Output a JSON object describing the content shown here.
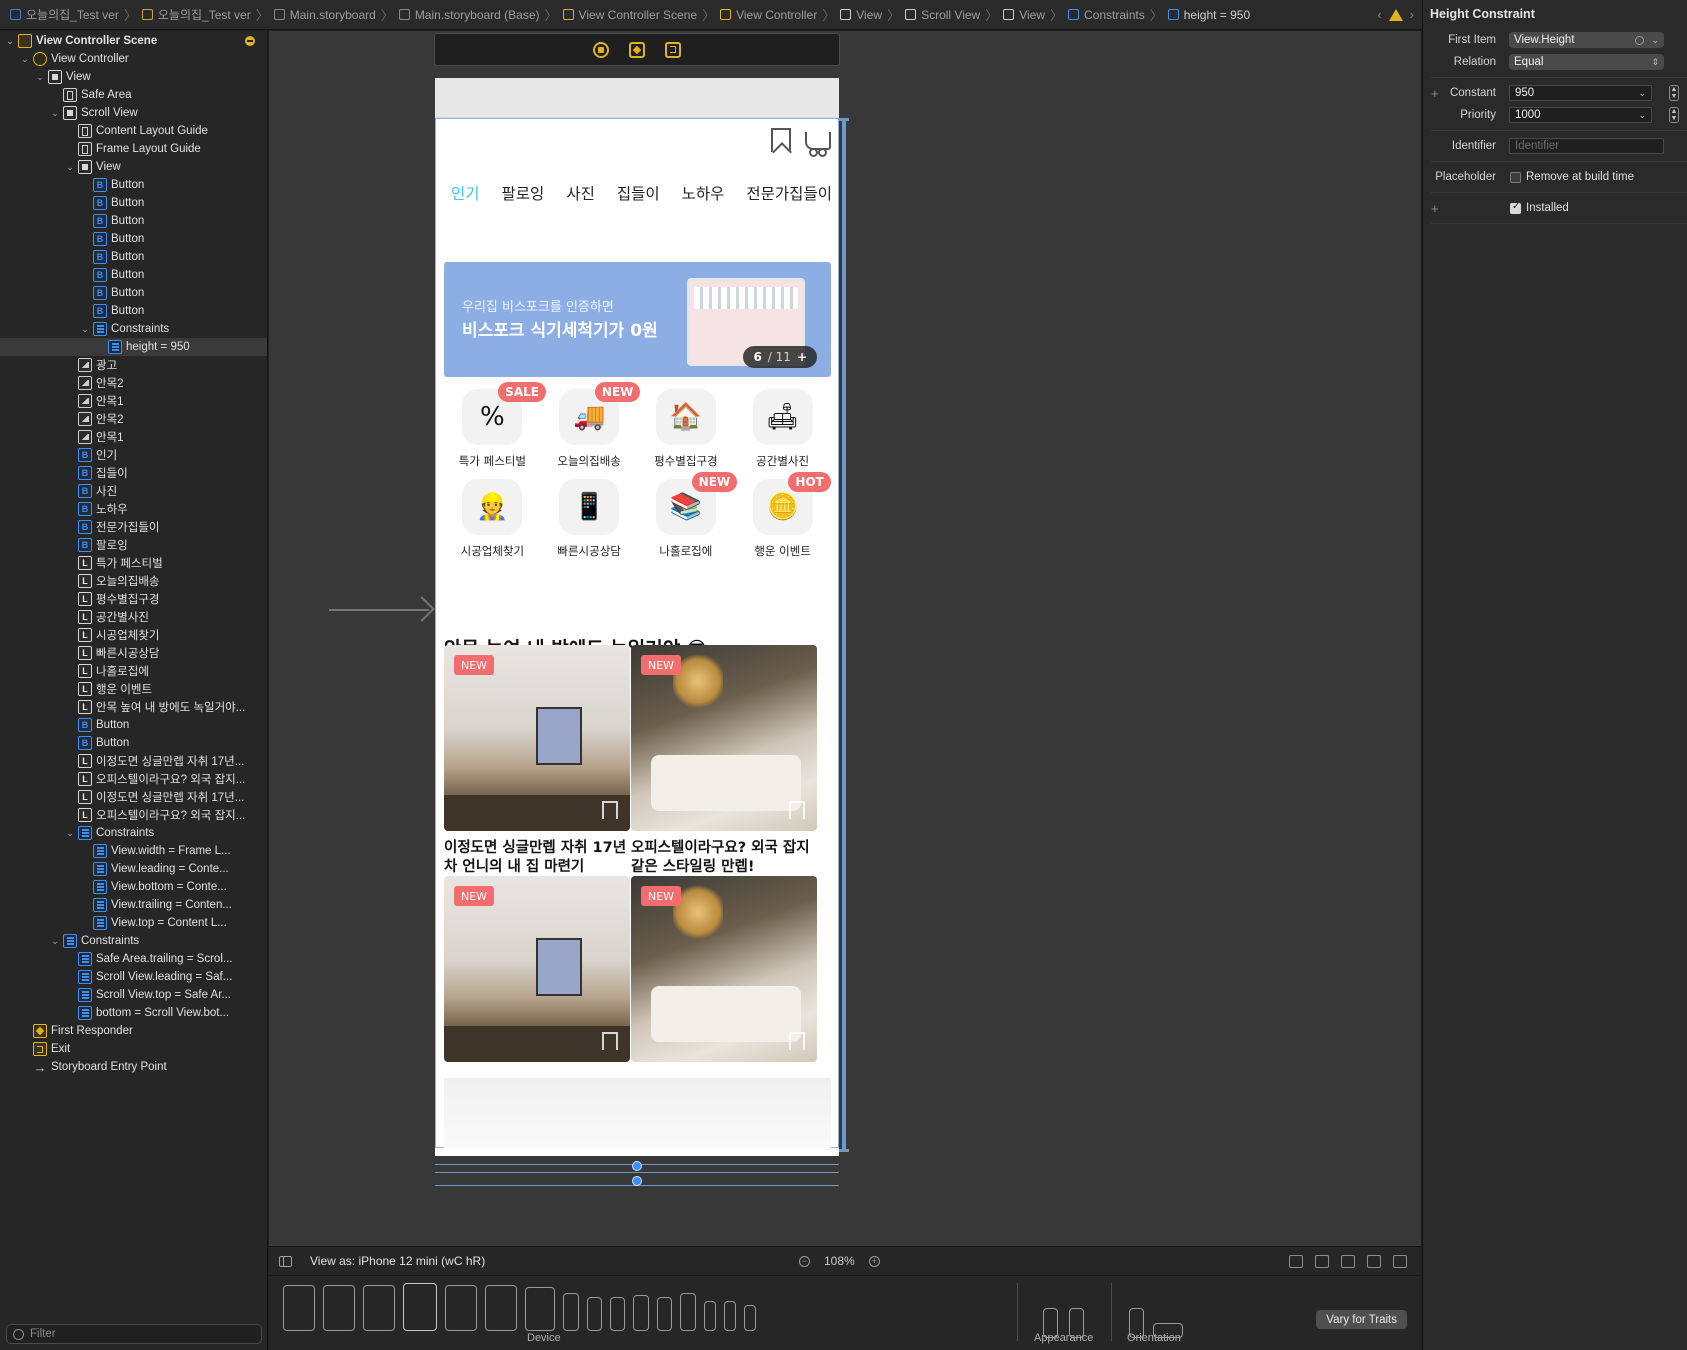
{
  "breadcrumbs": [
    {
      "label": "오늘의집_Test ver",
      "icon": "swift-file-icon",
      "color": "#4a7ad8"
    },
    {
      "label": "오늘의집_Test ver",
      "icon": "folder-icon",
      "color": "#c9a24a"
    },
    {
      "label": "Main.storyboard",
      "icon": "storyboard-icon",
      "color": "#8a8a8a"
    },
    {
      "label": "Main.storyboard (Base)",
      "icon": "storyboard-icon",
      "color": "#8a8a8a"
    },
    {
      "label": "View Controller Scene",
      "icon": "scene-icon",
      "color": "#e0b21c"
    },
    {
      "label": "View Controller",
      "icon": "view-controller-icon",
      "color": "#e0b21c"
    },
    {
      "label": "View",
      "icon": "view-icon",
      "color": "#cfcfcf"
    },
    {
      "label": "Scroll View",
      "icon": "scroll-view-icon",
      "color": "#cfcfcf"
    },
    {
      "label": "View",
      "icon": "view-icon",
      "color": "#cfcfcf"
    },
    {
      "label": "Constraints",
      "icon": "constraints-icon",
      "color": "#3d8ff5"
    },
    {
      "label": "height = 950",
      "icon": "constraint-icon",
      "color": "#3d8ff5"
    }
  ],
  "outline": {
    "items": [
      {
        "label": "View Controller Scene",
        "depth": 0,
        "icon": "scene",
        "disclosure": "▾",
        "bold": true
      },
      {
        "label": "View Controller",
        "depth": 1,
        "icon": "vc",
        "disclosure": "▾"
      },
      {
        "label": "View",
        "depth": 2,
        "icon": "view",
        "disclosure": "▾"
      },
      {
        "label": "Safe Area",
        "depth": 3,
        "icon": "guide",
        "disclosure": ""
      },
      {
        "label": "Scroll View",
        "depth": 3,
        "icon": "view",
        "disclosure": "▾"
      },
      {
        "label": "Content Layout Guide",
        "depth": 4,
        "icon": "guide",
        "disclosure": ""
      },
      {
        "label": "Frame Layout Guide",
        "depth": 4,
        "icon": "guide",
        "disclosure": ""
      },
      {
        "label": "View",
        "depth": 4,
        "icon": "view",
        "disclosure": "▾"
      },
      {
        "label": "Button",
        "depth": 5,
        "icon": "btn",
        "disclosure": ""
      },
      {
        "label": "Button",
        "depth": 5,
        "icon": "btn",
        "disclosure": ""
      },
      {
        "label": "Button",
        "depth": 5,
        "icon": "btn",
        "disclosure": ""
      },
      {
        "label": "Button",
        "depth": 5,
        "icon": "btn",
        "disclosure": ""
      },
      {
        "label": "Button",
        "depth": 5,
        "icon": "btn",
        "disclosure": ""
      },
      {
        "label": "Button",
        "depth": 5,
        "icon": "btn",
        "disclosure": ""
      },
      {
        "label": "Button",
        "depth": 5,
        "icon": "btn",
        "disclosure": ""
      },
      {
        "label": "Button",
        "depth": 5,
        "icon": "btn",
        "disclosure": ""
      },
      {
        "label": "Constraints",
        "depth": 5,
        "icon": "cons",
        "disclosure": "▾"
      },
      {
        "label": "height = 950",
        "depth": 6,
        "icon": "cons",
        "disclosure": "",
        "selected": true
      },
      {
        "label": "광고",
        "depth": 4,
        "icon": "img",
        "disclosure": ""
      },
      {
        "label": "안목2",
        "depth": 4,
        "icon": "img",
        "disclosure": ""
      },
      {
        "label": "안목1",
        "depth": 4,
        "icon": "img",
        "disclosure": ""
      },
      {
        "label": "안목2",
        "depth": 4,
        "icon": "img",
        "disclosure": ""
      },
      {
        "label": "안목1",
        "depth": 4,
        "icon": "img",
        "disclosure": ""
      },
      {
        "label": "인기",
        "depth": 4,
        "icon": "btn",
        "disclosure": ""
      },
      {
        "label": "집들이",
        "depth": 4,
        "icon": "btn",
        "disclosure": ""
      },
      {
        "label": "사진",
        "depth": 4,
        "icon": "btn",
        "disclosure": ""
      },
      {
        "label": "노하우",
        "depth": 4,
        "icon": "btn",
        "disclosure": ""
      },
      {
        "label": "전문가집들이",
        "depth": 4,
        "icon": "btn",
        "disclosure": ""
      },
      {
        "label": "팔로잉",
        "depth": 4,
        "icon": "btn",
        "disclosure": ""
      },
      {
        "label": "특가 페스티벌",
        "depth": 4,
        "icon": "lbl",
        "disclosure": ""
      },
      {
        "label": "오늘의집배송",
        "depth": 4,
        "icon": "lbl",
        "disclosure": ""
      },
      {
        "label": "평수별집구경",
        "depth": 4,
        "icon": "lbl",
        "disclosure": ""
      },
      {
        "label": "공간별사진",
        "depth": 4,
        "icon": "lbl",
        "disclosure": ""
      },
      {
        "label": "시공업체찾기",
        "depth": 4,
        "icon": "lbl",
        "disclosure": ""
      },
      {
        "label": "빠른시공상담",
        "depth": 4,
        "icon": "lbl",
        "disclosure": ""
      },
      {
        "label": "나홀로집에",
        "depth": 4,
        "icon": "lbl",
        "disclosure": ""
      },
      {
        "label": "행운 이벤트",
        "depth": 4,
        "icon": "lbl",
        "disclosure": ""
      },
      {
        "label": "안목 높여 내 방에도 녹일거야...",
        "depth": 4,
        "icon": "lbl",
        "disclosure": ""
      },
      {
        "label": "Button",
        "depth": 4,
        "icon": "btn",
        "disclosure": ""
      },
      {
        "label": "Button",
        "depth": 4,
        "icon": "btn",
        "disclosure": ""
      },
      {
        "label": "이정도면 싱글만렙 자취 17년...",
        "depth": 4,
        "icon": "lbl",
        "disclosure": ""
      },
      {
        "label": "오피스텔이라구요? 외국 잡지...",
        "depth": 4,
        "icon": "lbl",
        "disclosure": ""
      },
      {
        "label": "이정도면 싱글만렙 자취 17년...",
        "depth": 4,
        "icon": "lbl",
        "disclosure": ""
      },
      {
        "label": "오피스텔이라구요? 외국 잡지...",
        "depth": 4,
        "icon": "lbl",
        "disclosure": ""
      },
      {
        "label": "Constraints",
        "depth": 4,
        "icon": "cons",
        "disclosure": "▾"
      },
      {
        "label": "View.width = Frame L...",
        "depth": 5,
        "icon": "cons",
        "disclosure": ""
      },
      {
        "label": "View.leading = Conte...",
        "depth": 5,
        "icon": "cons",
        "disclosure": ""
      },
      {
        "label": "View.bottom = Conte...",
        "depth": 5,
        "icon": "cons",
        "disclosure": ""
      },
      {
        "label": "View.trailing = Conten...",
        "depth": 5,
        "icon": "cons",
        "disclosure": ""
      },
      {
        "label": "View.top = Content L...",
        "depth": 5,
        "icon": "cons",
        "disclosure": ""
      },
      {
        "label": "Constraints",
        "depth": 3,
        "icon": "cons",
        "disclosure": "▾"
      },
      {
        "label": "Safe Area.trailing = Scrol...",
        "depth": 4,
        "icon": "cons",
        "disclosure": ""
      },
      {
        "label": "Scroll View.leading = Saf...",
        "depth": 4,
        "icon": "cons",
        "disclosure": ""
      },
      {
        "label": "Scroll View.top = Safe Ar...",
        "depth": 4,
        "icon": "cons",
        "disclosure": ""
      },
      {
        "label": "bottom = Scroll View.bot...",
        "depth": 4,
        "icon": "cons",
        "disclosure": ""
      },
      {
        "label": "First Responder",
        "depth": 1,
        "icon": "resp",
        "disclosure": ""
      },
      {
        "label": "Exit",
        "depth": 1,
        "icon": "exit",
        "disclosure": ""
      },
      {
        "label": "Storyboard Entry Point",
        "depth": 1,
        "icon": "arrow",
        "disclosure": ""
      }
    ],
    "filter_placeholder": "Filter"
  },
  "app": {
    "tabs": [
      "인기",
      "팔로잉",
      "사진",
      "집들이",
      "노하우",
      "전문가집들이"
    ],
    "active_tab": "인기",
    "banner": {
      "sub": "우리집 비스포크를 인증하면",
      "main": "비스포크 식기세척기가 0원",
      "page": "6",
      "total": "/ 11",
      "plus": "+"
    },
    "categories": [
      {
        "label": "특가 페스티벌",
        "badge": "SALE",
        "icon": "%"
      },
      {
        "label": "오늘의집배송",
        "badge": "NEW",
        "icon": "🚚"
      },
      {
        "label": "평수별집구경",
        "badge": "",
        "icon": "🏠"
      },
      {
        "label": "공간별사진",
        "badge": "",
        "icon": "🛋"
      },
      {
        "label": "시공업체찾기",
        "badge": "",
        "icon": "👷"
      },
      {
        "label": "빠른시공상담",
        "badge": "",
        "icon": "📱"
      },
      {
        "label": "나홀로집에",
        "badge": "NEW",
        "icon": "📚"
      },
      {
        "label": "행운 이벤트",
        "badge": "HOT",
        "icon": "🪙"
      }
    ],
    "section_title": "안목 높여 내 방에도 녹일거야 😎",
    "cards": [
      {
        "badge": "NEW",
        "title": "이정도면 싱글만렙 자취 17년차 언니의 내 집 마련기",
        "style": "living"
      },
      {
        "badge": "NEW",
        "title": "오피스텔이라구요? 외국 잡지 같은 스타일링 만렙!",
        "style": "loft"
      },
      {
        "badge": "NEW",
        "title": "",
        "style": "living"
      },
      {
        "badge": "NEW",
        "title": "",
        "style": "loft"
      }
    ]
  },
  "bottom_bar": {
    "view_as": "View as: iPhone 12 mini (wC hR)",
    "zoom": "108%",
    "device_caption": "Device",
    "appearance_caption": "Appearance",
    "orientation_caption": "Orientation",
    "vary_button": "Vary for Traits"
  },
  "inspector": {
    "title": "Height Constraint",
    "first_item_label": "First Item",
    "first_item": "View.Height",
    "relation_label": "Relation",
    "relation": "Equal",
    "constant_label": "Constant",
    "constant": "950",
    "priority_label": "Priority",
    "priority": "1000",
    "identifier_label": "Identifier",
    "identifier_placeholder": "Identifier",
    "placeholder_label": "Placeholder",
    "remove_at_build": "Remove at build time",
    "installed": "Installed"
  },
  "colors": {
    "accent": "#35c5f0",
    "badge": "#f26d6d",
    "banner": "#8daee5",
    "xcode_warning": "#e0b21c",
    "xcode_blue": "#3d8ff5"
  }
}
